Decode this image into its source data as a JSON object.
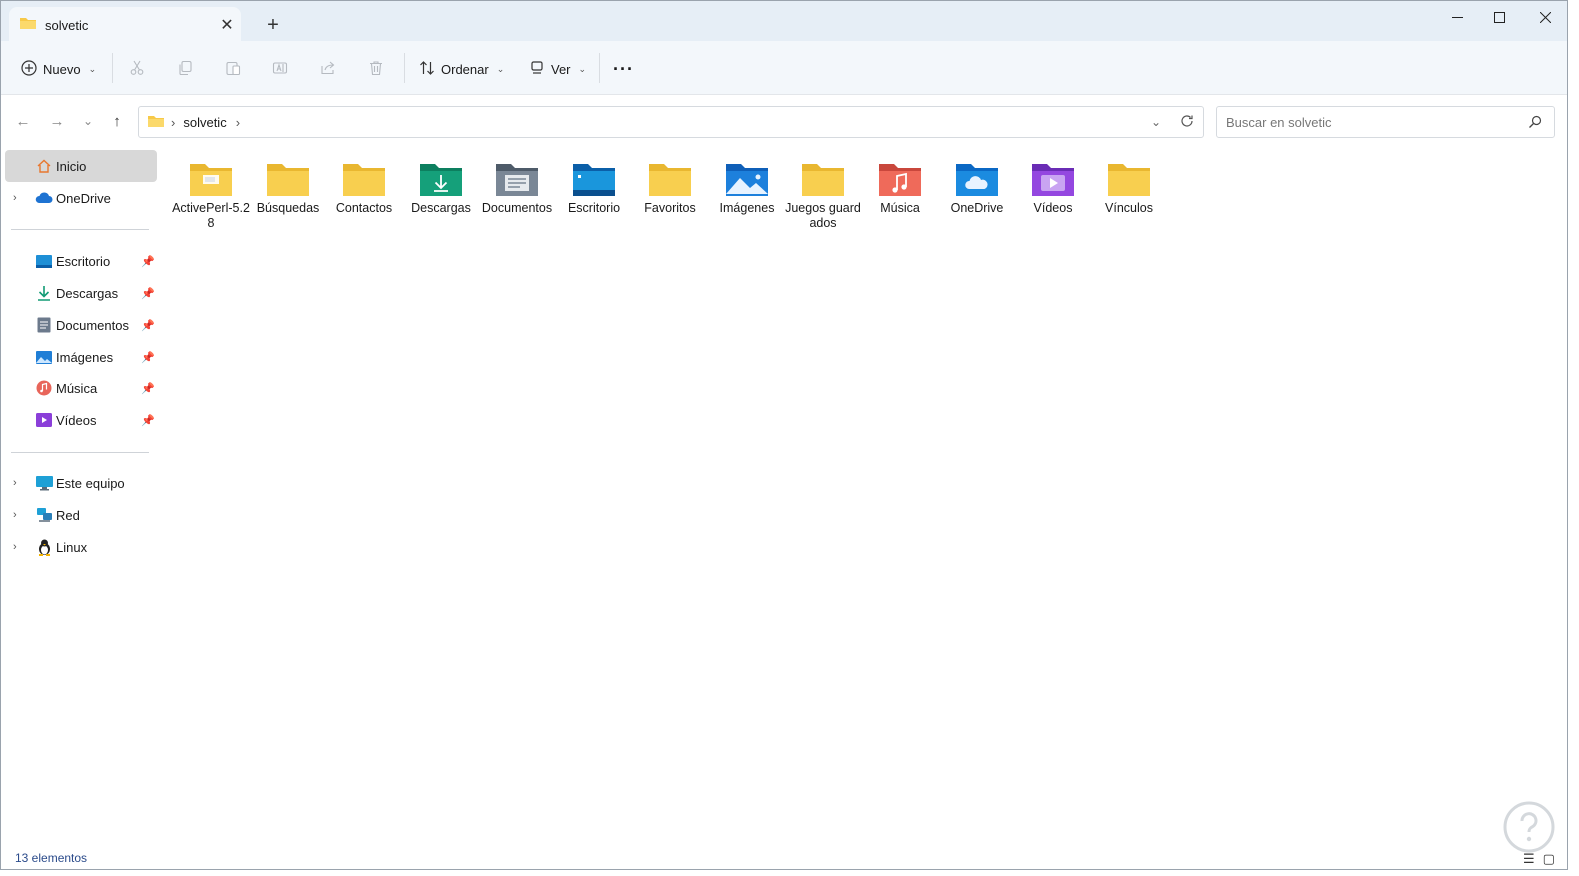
{
  "window": {
    "tab_title": "solvetic",
    "new_tab_label": "+"
  },
  "commandbar": {
    "new_label": "Nuevo",
    "sort_label": "Ordenar",
    "view_label": "Ver",
    "more_label": "···"
  },
  "nav": {
    "breadcrumb": "solvetic",
    "search_placeholder": "Buscar en solvetic"
  },
  "sidebar": {
    "top_items": [
      {
        "label": "Inicio"
      },
      {
        "label": "OneDrive"
      }
    ],
    "quick_access": [
      {
        "label": "Escritorio"
      },
      {
        "label": "Descargas"
      },
      {
        "label": "Documentos"
      },
      {
        "label": "Imágenes"
      },
      {
        "label": "Música"
      },
      {
        "label": "Vídeos"
      }
    ],
    "bottom_items": [
      {
        "label": "Este equipo"
      },
      {
        "label": "Red"
      },
      {
        "label": "Linux"
      }
    ]
  },
  "folders": [
    {
      "label": "ActivePerl-5.28",
      "icon": "folder-icon"
    },
    {
      "label": "Búsquedas",
      "icon": "folder-icon"
    },
    {
      "label": "Contactos",
      "icon": "folder-icon"
    },
    {
      "label": "Descargas",
      "icon": "downloads-folder-icon"
    },
    {
      "label": "Documentos",
      "icon": "documents-folder-icon"
    },
    {
      "label": "Escritorio",
      "icon": "desktop-folder-icon"
    },
    {
      "label": "Favoritos",
      "icon": "folder-icon"
    },
    {
      "label": "Imágenes",
      "icon": "pictures-folder-icon"
    },
    {
      "label": "Juegos guardados",
      "icon": "folder-icon"
    },
    {
      "label": "Música",
      "icon": "music-folder-icon"
    },
    {
      "label": "OneDrive",
      "icon": "onedrive-folder-icon"
    },
    {
      "label": "Vídeos",
      "icon": "videos-folder-icon"
    },
    {
      "label": "Vínculos",
      "icon": "folder-icon"
    }
  ],
  "status": {
    "item_count": "13 elementos"
  },
  "colors": {
    "folder_yellow": "#f7c948",
    "titlebar_bg": "#e6eef6",
    "accent_blue": "#1e73d2"
  }
}
